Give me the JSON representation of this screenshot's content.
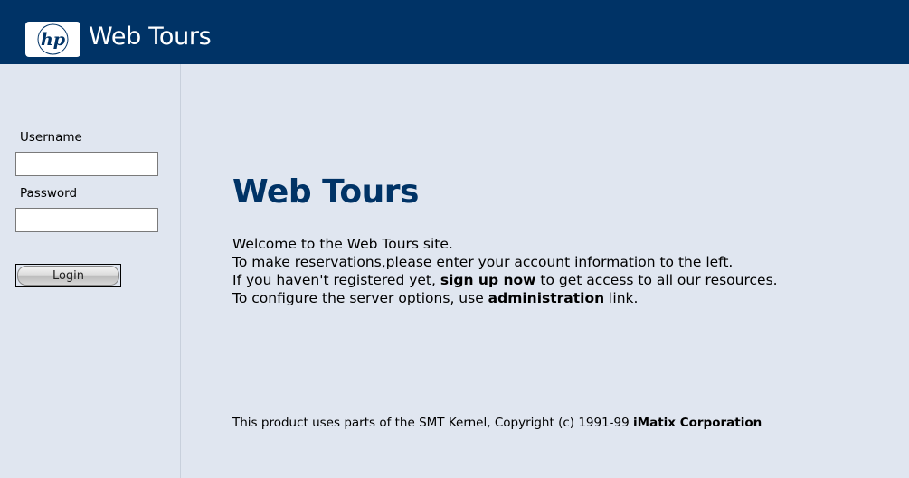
{
  "header": {
    "logo_icon": "hp-logo-icon",
    "title": "Web Tours",
    "background": "#003366"
  },
  "login": {
    "username_label": "Username",
    "username_value": "",
    "password_label": "Password",
    "password_value": "",
    "button_label": "Login"
  },
  "main": {
    "title": "Web Tours",
    "line1": "Welcome to the Web Tours site.",
    "line2": "To make reservations,please enter your account information to the left.",
    "line3_before": "If you haven't registered yet, ",
    "line3_link": "sign up now",
    "line3_after": " to get access to all our resources.",
    "line4_before": "To configure the server options, use ",
    "line4_link": "administration",
    "line4_after": " link.",
    "title_color": "#003366"
  },
  "footer": {
    "text": "This product uses parts of the SMT Kernel, Copyright (c) 1991-99 ",
    "company": "iMatix Corporation"
  }
}
